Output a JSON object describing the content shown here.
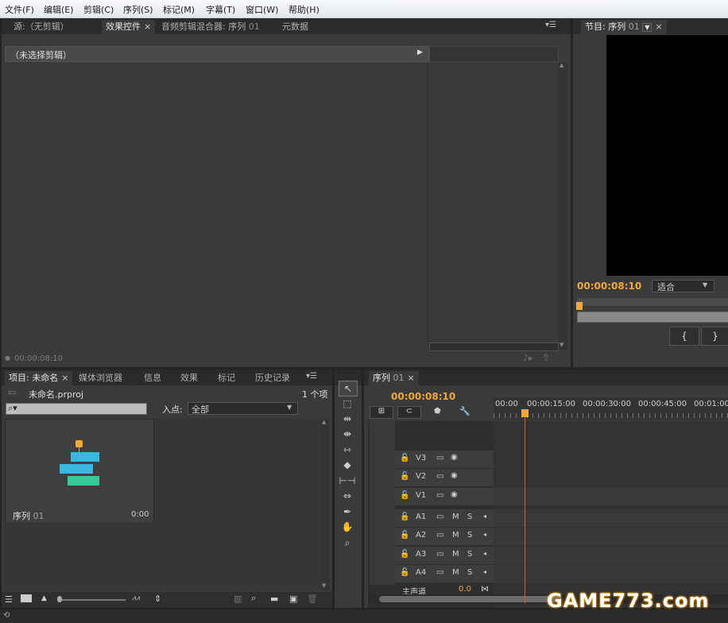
{
  "menu": [
    "文件(F)",
    "编辑(E)",
    "剪辑(C)",
    "序列(S)",
    "标记(M)",
    "字幕(T)",
    "窗口(W)",
    "帮助(H)"
  ],
  "source_panel": {
    "tabs": [
      {
        "label": "源:（无剪辑）",
        "closable": false
      },
      {
        "label": "效果控件",
        "closable": true
      },
      {
        "label": "音频剪辑混合器: 序列",
        "suffix": "01",
        "closable": false
      },
      {
        "label": "元数据",
        "closable": false
      }
    ],
    "no_clip": "（未选择剪辑）",
    "timecode": "00:00:08:10"
  },
  "program_panel": {
    "tab": "节目: 序列",
    "tab_suffix": "01",
    "timecode": "00:00:08:10",
    "fit": "适合",
    "mark_in": "{",
    "mark_out": "}"
  },
  "project_panel": {
    "tabs": [
      {
        "label": "项目: 未命名",
        "closable": true
      },
      {
        "label": "媒体浏览器",
        "closable": false
      },
      {
        "label": "信息",
        "closable": false
      },
      {
        "label": "效果",
        "closable": false
      },
      {
        "label": "标记",
        "closable": false
      },
      {
        "label": "历史记录",
        "closable": false
      }
    ],
    "project_file": "未命名.prproj",
    "item_count": "1 个项",
    "in_point_label": "入点:",
    "in_point_value": "全部",
    "item": {
      "name": "序列",
      "suffix": "01",
      "duration": "0:00"
    }
  },
  "timeline": {
    "tab": "序列",
    "tab_suffix": "01",
    "timecode": "00:00:08:10",
    "ruler": [
      "00:00",
      "00:00:15:00",
      "00:00:30:00",
      "00:00:45:00",
      "00:01:00"
    ],
    "video_tracks": [
      "V3",
      "V2",
      "V1"
    ],
    "audio_tracks": [
      "A1",
      "A2",
      "A3",
      "A4"
    ],
    "master": "主声道",
    "master_value": "0.0",
    "track_buttons": {
      "mute": "M",
      "solo": "S"
    }
  },
  "watermark": "GAME773.com",
  "colors": {
    "accent": "#f0a93a",
    "playhead": "#e0573a"
  },
  "icons": [
    "selection-tool-icon",
    "track-select-icon",
    "ripple-edit-icon",
    "rolling-edit-icon",
    "rate-stretch-icon",
    "razor-icon",
    "slip-icon",
    "slide-icon",
    "pen-icon",
    "hand-icon",
    "zoom-icon",
    "lock-icon",
    "camera-icon",
    "eye-icon",
    "search-icon",
    "folder-icon",
    "wrench-icon",
    "marker-icon",
    "snap-icon"
  ]
}
